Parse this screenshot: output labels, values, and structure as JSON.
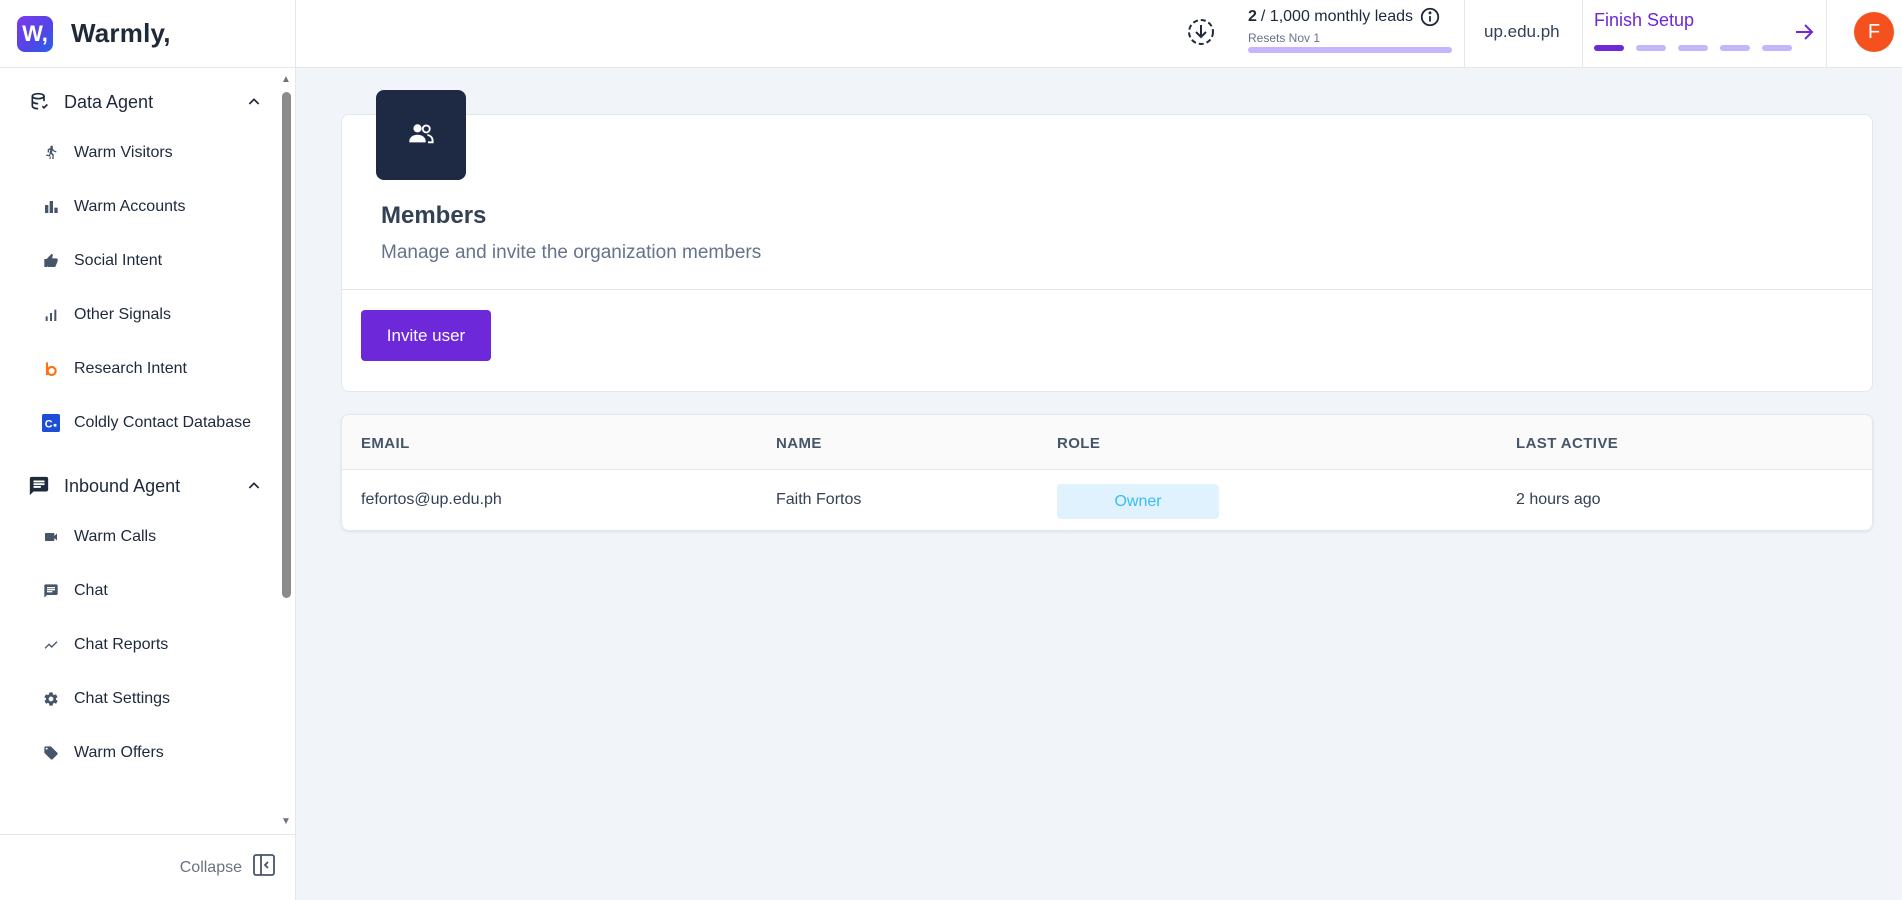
{
  "brand": {
    "logo_letter": "W,",
    "name": "Warmly,"
  },
  "sidebar": {
    "sections": [
      {
        "label": "Data Agent",
        "icon": "database-icon",
        "items": [
          {
            "label": "Warm Visitors",
            "icon": "walking-person-icon"
          },
          {
            "label": "Warm Accounts",
            "icon": "bar-chart-icon"
          },
          {
            "label": "Social Intent",
            "icon": "thumbs-up-icon"
          },
          {
            "label": "Other Signals",
            "icon": "signal-bars-icon"
          },
          {
            "label": "Research Intent",
            "icon": "bombora-b-icon"
          },
          {
            "label": "Coldly Contact Database",
            "icon": "coldly-logo-icon"
          }
        ]
      },
      {
        "label": "Inbound Agent",
        "icon": "chat-box-icon",
        "items": [
          {
            "label": "Warm Calls",
            "icon": "video-camera-icon"
          },
          {
            "label": "Chat",
            "icon": "chat-icon"
          },
          {
            "label": "Chat Reports",
            "icon": "trend-line-icon"
          },
          {
            "label": "Chat Settings",
            "icon": "gear-icon"
          },
          {
            "label": "Warm Offers",
            "icon": "tag-icon"
          }
        ]
      }
    ],
    "collapse_label": "Collapse"
  },
  "header": {
    "leads_count": "2",
    "leads_suffix": "/ 1,000 monthly leads",
    "leads_progress": 0.002,
    "resets": "Resets Nov 1",
    "domain": "up.edu.ph",
    "setup_title": "Finish Setup",
    "setup_steps_total": 5,
    "setup_steps_done": 1,
    "avatar_letter": "F"
  },
  "members": {
    "title": "Members",
    "subtitle": "Manage and invite the organization members",
    "invite_label": "Invite user"
  },
  "table": {
    "columns": [
      "EMAIL",
      "NAME",
      "ROLE",
      "LAST ACTIVE"
    ],
    "rows": [
      {
        "email": "fefortos@up.edu.ph",
        "name": "Faith Fortos",
        "role": "Owner",
        "last_active": "2 hours ago"
      }
    ]
  },
  "colors": {
    "accent": "#6d28d9",
    "tile": "#1e2a44",
    "avatar": "#f4511e",
    "badge_bg": "#e0f2fe",
    "badge_text": "#38bdf8"
  }
}
